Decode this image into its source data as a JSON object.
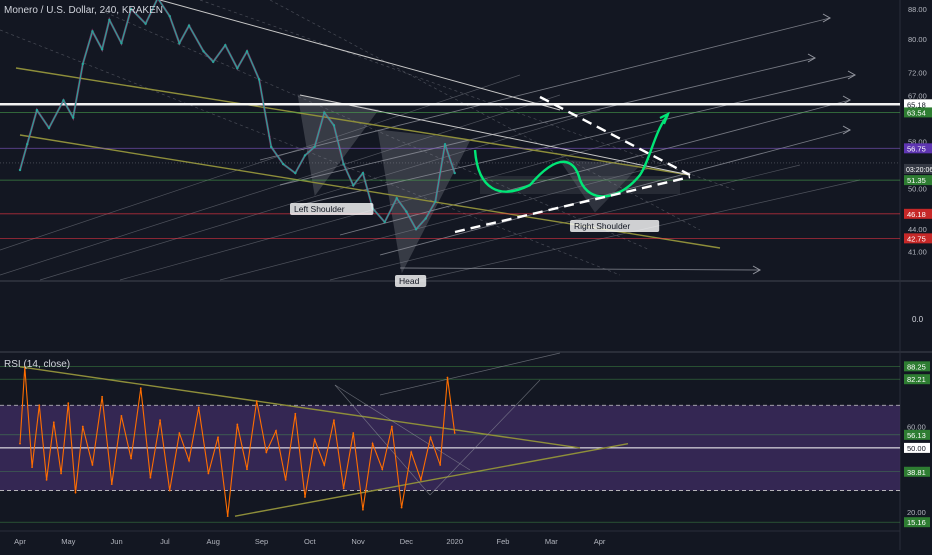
{
  "header": {
    "symbol_title": "Monero / U.S. Dollar, 240, KRAKEN",
    "rsi_title": "RSI (14, close)"
  },
  "colors": {
    "background": "#131722",
    "candle_up": "#26a69a",
    "candle_down": "#b04a8a",
    "wedge_line": "#8e8e3a",
    "gray_line": "#9598a1",
    "white_level": "#ffffff",
    "red_level": "#f23645",
    "green_level": "#4caf50",
    "projection": "#00e676",
    "rsi_line": "#ff6d00",
    "rsi_band": "#3b2a5c",
    "price_tag_white": "#ffffff",
    "price_tag_green": "#2e7d32",
    "price_tag_red": "#c62828",
    "price_tag_purple": "#5e35b1"
  },
  "chart_data": [
    {
      "type": "line",
      "name": "price",
      "x_axis": {
        "ticks": [
          "Apr",
          "May",
          "Jun",
          "Jul",
          "Aug",
          "Sep",
          "Oct",
          "Nov",
          "Dec",
          "2020",
          "Feb",
          "Mar",
          "Apr"
        ],
        "span_months": [
          0,
          13
        ]
      },
      "y_axis": {
        "ticks": [
          88.0,
          80.0,
          72.0,
          67.0,
          58.0,
          50.0,
          44.0,
          41.0
        ],
        "ylim": [
          37.5,
          90.5
        ],
        "scale": "log"
      },
      "series": [
        {
          "x": [
            0,
            0.15,
            0.35,
            0.6,
            0.9,
            1.1,
            1.3,
            1.5,
            1.7,
            1.85,
            2.1,
            2.3,
            2.6,
            2.85,
            3.1,
            3.3,
            3.5,
            3.8,
            4.0,
            4.25,
            4.5,
            4.7,
            4.95,
            5.2,
            5.45,
            5.7,
            5.9,
            6.1,
            6.3,
            6.5,
            6.7,
            6.9,
            7.1,
            7.3,
            7.55,
            7.8,
            8.0,
            8.2,
            8.4,
            8.6,
            8.8,
            9.0
          ],
          "values": [
            53.0,
            57.5,
            64.0,
            60.5,
            66.0,
            62.5,
            74.0,
            82.0,
            77.5,
            85.0,
            79.0,
            88.0,
            84.0,
            91.0,
            86.0,
            79.0,
            83.5,
            77.0,
            74.5,
            78.5,
            73.0,
            77.0,
            70.5,
            57.0,
            54.0,
            52.5,
            55.5,
            57.0,
            63.5,
            61.0,
            54.0,
            50.5,
            52.5,
            47.0,
            45.0,
            48.5,
            46.5,
            44.0,
            45.5,
            48.0,
            57.5,
            52.5
          ]
        }
      ],
      "horizontal_levels": [
        {
          "label": "65.18",
          "value": 65.18,
          "color": "#ffffff"
        },
        {
          "label": "63.54",
          "value": 63.54,
          "color": "#4caf50"
        },
        {
          "label": "56.75",
          "value": 56.75,
          "color": "#7e57c2"
        },
        {
          "label": "51.35",
          "value": 51.35,
          "color": "#4caf50"
        },
        {
          "label": "46.18",
          "value": 46.18,
          "color": "#f23645"
        },
        {
          "label": "42.75",
          "value": 42.75,
          "color": "#f23645"
        }
      ],
      "current_price": {
        "value": 54.2,
        "countdown": "03:20:06"
      },
      "annotations": [
        "Left Shoulder",
        "Right Shoulder",
        "Head"
      ]
    },
    {
      "type": "line",
      "name": "RSI (14, close)",
      "y_axis": {
        "ticks": [
          88.25,
          82.21,
          60.0,
          56.13,
          50.0,
          38.81,
          20.0,
          15.16
        ],
        "ylim": [
          11.5,
          94.5
        ]
      },
      "levels": {
        "upper": 70,
        "middle": 50,
        "lower": 30
      },
      "series": [
        {
          "x": [
            0,
            0.1,
            0.25,
            0.4,
            0.55,
            0.7,
            0.85,
            1.0,
            1.15,
            1.3,
            1.5,
            1.7,
            1.9,
            2.1,
            2.3,
            2.5,
            2.7,
            2.9,
            3.1,
            3.3,
            3.5,
            3.7,
            3.9,
            4.1,
            4.3,
            4.5,
            4.7,
            4.9,
            5.1,
            5.3,
            5.5,
            5.7,
            5.9,
            6.1,
            6.3,
            6.5,
            6.7,
            6.9,
            7.1,
            7.3,
            7.5,
            7.7,
            7.9,
            8.1,
            8.3,
            8.5,
            8.7,
            8.85,
            9.0
          ],
          "values": [
            52,
            88,
            41,
            70,
            35,
            62,
            38,
            71,
            29,
            60,
            42,
            74,
            33,
            65,
            45,
            78,
            36,
            63,
            30,
            57,
            44,
            69,
            38,
            55,
            18,
            61,
            40,
            72,
            48,
            58,
            35,
            66,
            27,
            54,
            42,
            63,
            31,
            57,
            21,
            52,
            40,
            60,
            22,
            48,
            35,
            55,
            42,
            83,
            57
          ]
        }
      ]
    }
  ]
}
